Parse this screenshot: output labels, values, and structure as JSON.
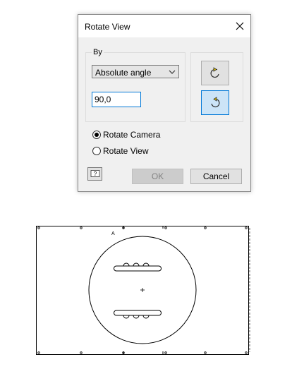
{
  "dialog": {
    "title": "Rotate View",
    "group_label": "By",
    "mode_select": {
      "value": "Absolute angle"
    },
    "angle_input": {
      "value": "90,0"
    },
    "radios": [
      {
        "label": "Rotate Camera",
        "checked": true
      },
      {
        "label": "Rotate View",
        "checked": false
      }
    ],
    "buttons": {
      "ok": "OK",
      "cancel": "Cancel"
    }
  },
  "drawing": {
    "label": "A"
  },
  "colors": {
    "selected_fill": "#cce4f7",
    "focus_border": "#0078d7",
    "arrow_yellow": "#e0c000"
  },
  "icons": [
    "close-icon",
    "chevron-down-icon",
    "rotate-ccw-icon",
    "rotate-cw-icon",
    "help-icon"
  ]
}
